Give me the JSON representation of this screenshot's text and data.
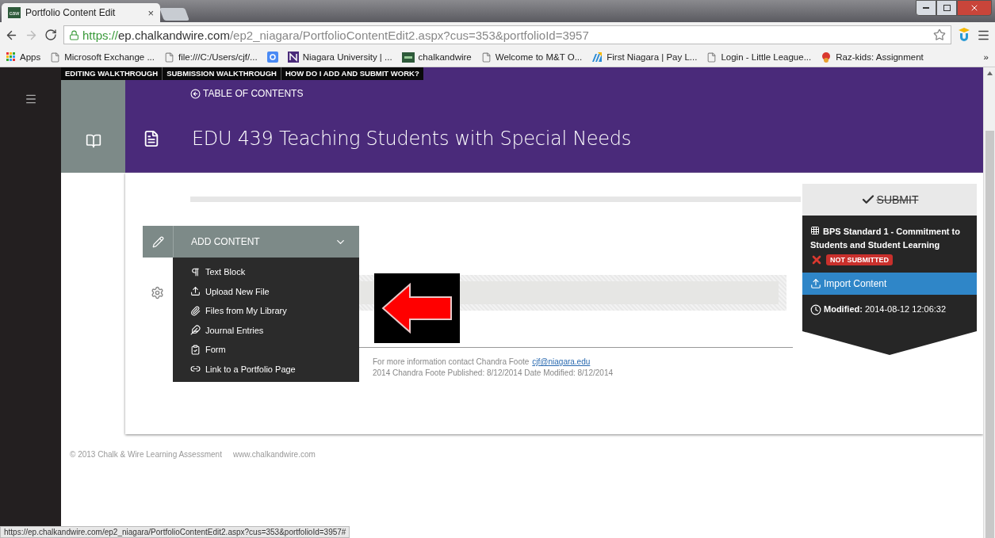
{
  "browser": {
    "tab": {
      "title": "Portfolio Content Edit",
      "close": "×"
    },
    "address": {
      "scheme": "https://",
      "host": "ep.chalkandwire.com",
      "path": "/ep2_niagara/PortfolioContentEdit2.aspx?cus=353&portfolioId=3957"
    },
    "bookmarks": [
      {
        "label": "Apps",
        "kind": "apps"
      },
      {
        "label": "Microsoft Exchange ...",
        "kind": "page"
      },
      {
        "label": "file:///C:/Users/cjf/...",
        "kind": "page"
      },
      {
        "kind": "google"
      },
      {
        "label": "Niagara University | ...",
        "kind": "niagara"
      },
      {
        "label": "chalkandwire",
        "kind": "caw"
      },
      {
        "label": "Welcome to M&T O...",
        "kind": "page"
      },
      {
        "label": "First Niagara | Pay L...",
        "kind": "bank"
      },
      {
        "label": "Login - Little League...",
        "kind": "page"
      },
      {
        "label": "Raz-kids: Assignment",
        "kind": "raz"
      }
    ],
    "overflow": "»"
  },
  "help_links": [
    "EDITING WALKTHROUGH",
    "SUBMISSION WALKTHROUGH",
    "HOW DO I ADD AND SUBMIT WORK?"
  ],
  "header": {
    "toc_link": "TABLE OF CONTENTS",
    "title": "EDU 439 Teaching Students with Special Needs"
  },
  "add_content": {
    "label": "ADD CONTENT",
    "expanded": true,
    "items": [
      {
        "label": "Text Block",
        "kind": "paragraph"
      },
      {
        "label": "Upload New File",
        "kind": "upload"
      },
      {
        "label": "Files from My Library",
        "kind": "attach"
      },
      {
        "label": "Journal Entries",
        "kind": "quill"
      },
      {
        "label": "Form",
        "kind": "form"
      },
      {
        "label": "Link to a Portfolio Page",
        "kind": "link"
      }
    ]
  },
  "footer_info": {
    "contact_text": "For more information contact Chandra Foote",
    "email": "cjf@niagara.edu",
    "meta": "2014 Chandra Foote Published: 8/12/2014 Date Modified: 8/12/2014"
  },
  "submit_panel": {
    "submit_label": "SUBMIT",
    "standard": "BPS Standard 1 - Commitment to Students and Student Learning",
    "status": "NOT SUBMITTED",
    "import_button": "Import Content",
    "modified_label": "Modified:",
    "modified_value": "2014-08-12 12:06:32"
  },
  "copyright": "© 2013 Chalk & Wire Learning Assessment",
  "site": "www.chalkandwire.com",
  "status_url": "https://ep.chalkandwire.com/ep2_niagara/PortfolioContentEdit2.aspx?cus=353&portfolioId=3957#"
}
